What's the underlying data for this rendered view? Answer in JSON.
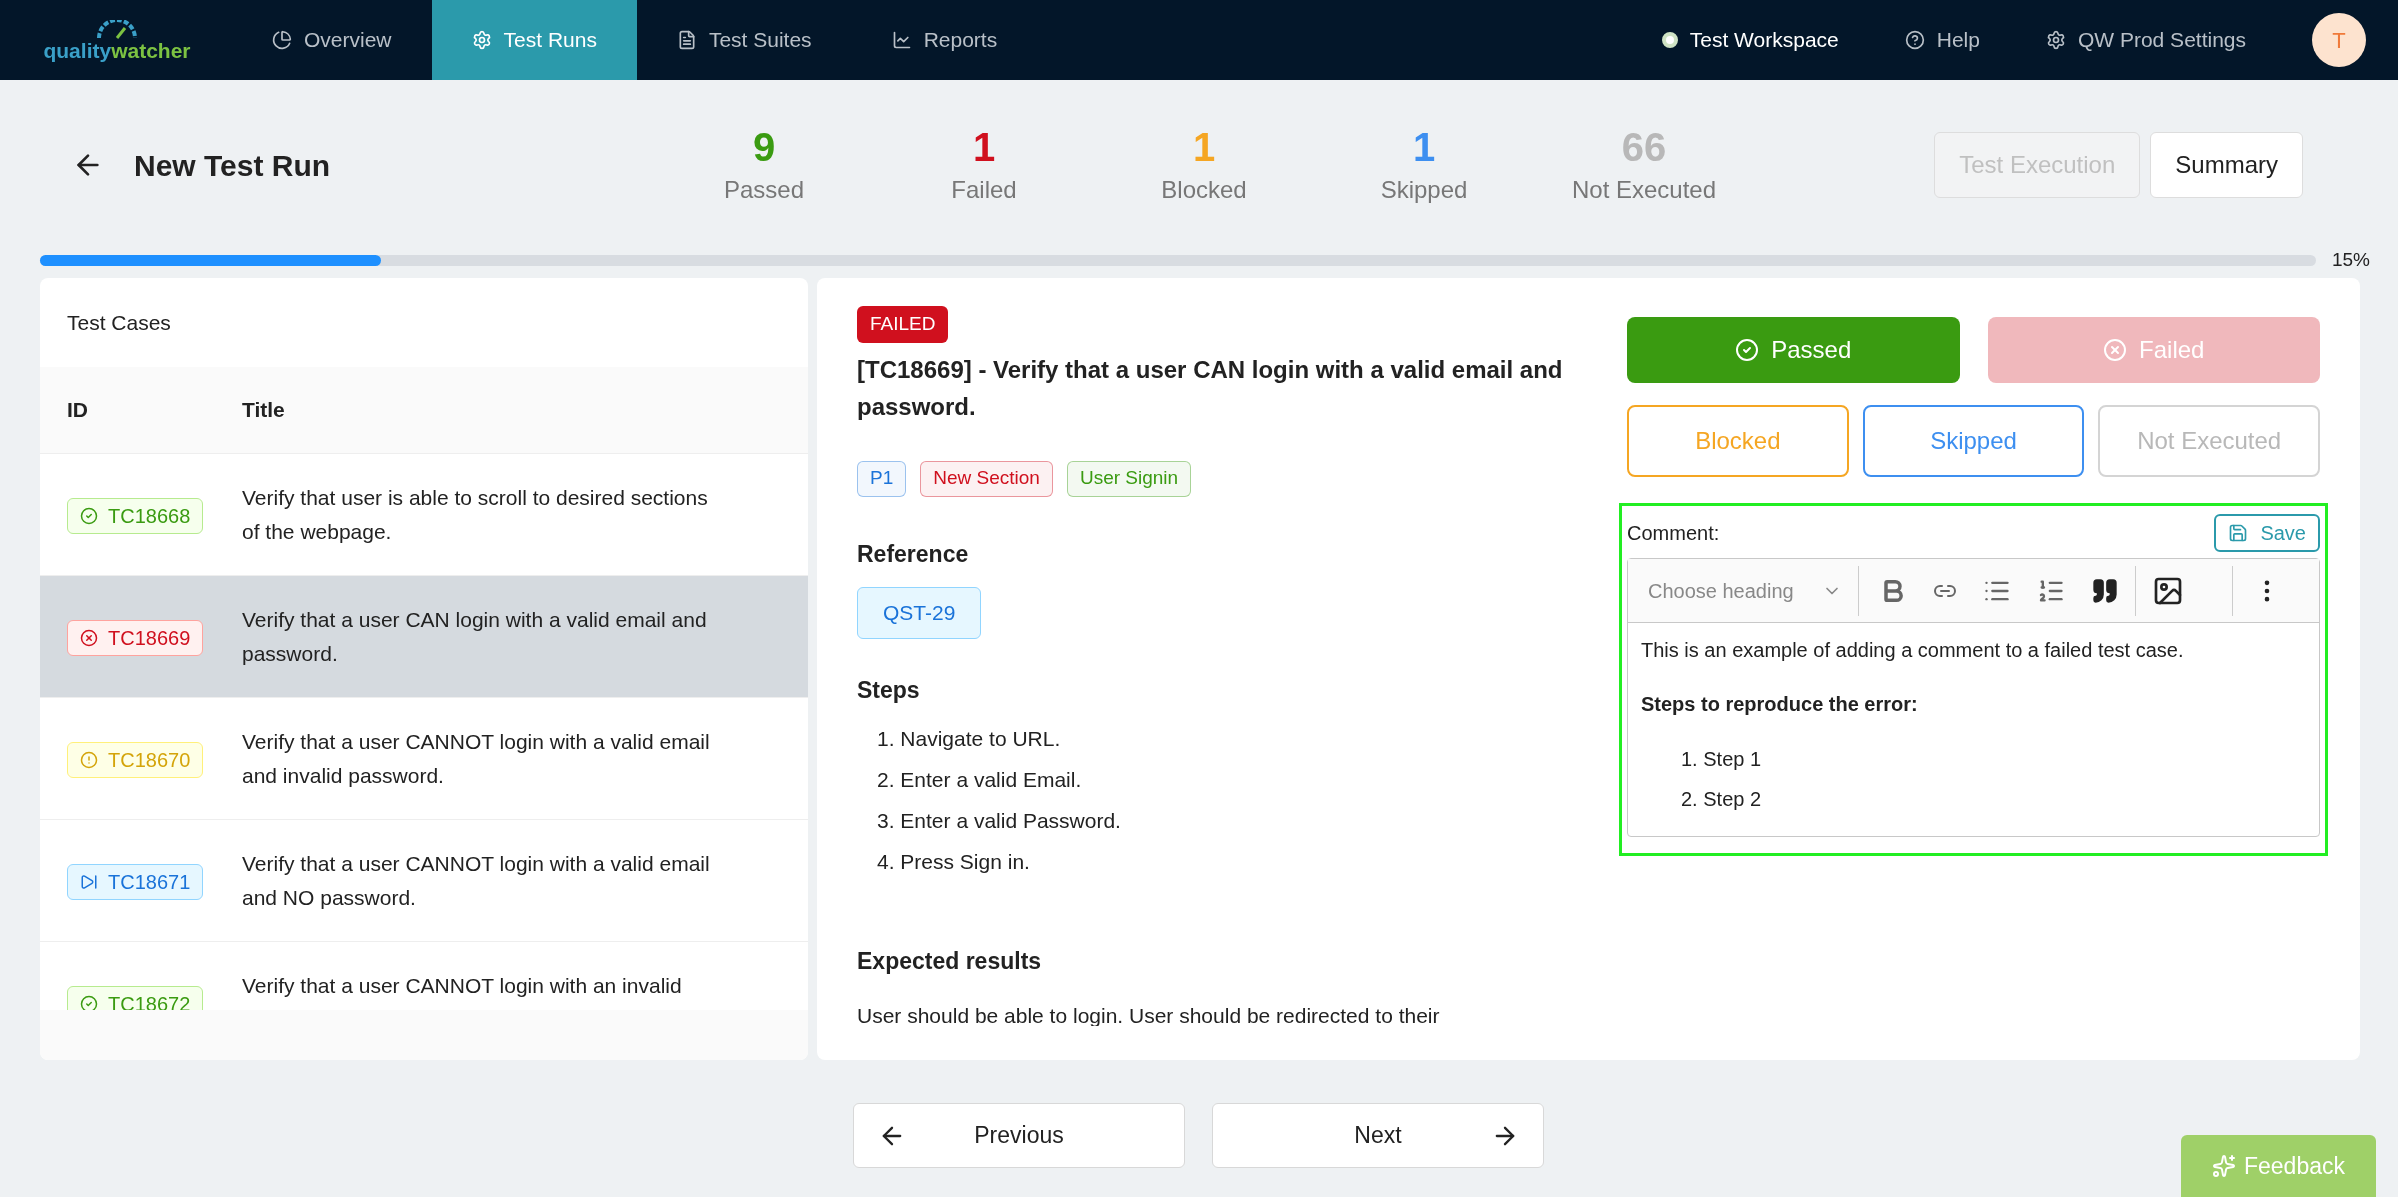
{
  "nav": {
    "logo": [
      "quality",
      "watcher"
    ],
    "items": [
      {
        "label": "Overview",
        "selected": false
      },
      {
        "label": "Test Runs",
        "selected": true
      },
      {
        "label": "Test Suites",
        "selected": false
      },
      {
        "label": "Reports",
        "selected": false
      }
    ],
    "right": [
      "Test Workspace",
      "Help",
      "QW Prod Settings"
    ],
    "avatar": "T"
  },
  "header": {
    "title": "New Test Run",
    "stats": [
      {
        "value": "9",
        "label": "Passed",
        "color": "#3a9b11"
      },
      {
        "value": "1",
        "label": "Failed",
        "color": "#d0101e"
      },
      {
        "value": "1",
        "label": "Blocked",
        "color": "#f5a623"
      },
      {
        "value": "1",
        "label": "Skipped",
        "color": "#3d8ff0"
      },
      {
        "value": "66",
        "label": "Not Executed",
        "color": "#b8b8b8"
      }
    ],
    "buttons": [
      {
        "label": "Test Execution",
        "disabled": true
      },
      {
        "label": "Summary",
        "disabled": false
      }
    ],
    "progress": {
      "level": 0.15,
      "reading": "15%"
    }
  },
  "test_cases": {
    "title": "Test Cases",
    "columns": [
      "ID",
      "Title"
    ],
    "rows": [
      {
        "id": "TC18668",
        "kind": "passed",
        "title": "Verify that user is able to scroll to desired sections of the webpage.",
        "selected": false
      },
      {
        "id": "TC18669",
        "kind": "failed",
        "title": "Verify that a user CAN login with a valid email and password.",
        "selected": true
      },
      {
        "id": "TC18670",
        "kind": "blocked",
        "title": "Verify that a user CANNOT login with a valid email and invalid password.",
        "selected": false
      },
      {
        "id": "TC18671",
        "kind": "skipped",
        "title": "Verify that a user CANNOT login with a valid email and NO password.",
        "selected": false
      },
      {
        "id": "TC18672",
        "kind": "passed",
        "title": "Verify that a user CANNOT login with an invalid",
        "selected": false
      }
    ]
  },
  "detail": {
    "status": "FAILED",
    "title": "[TC18669] - Verify that a user CAN login with a valid email and password.",
    "tags": [
      {
        "text": "P1",
        "color": "#1a73d9"
      },
      {
        "text": "New Section",
        "color": "#d0101e"
      },
      {
        "text": "User Signin",
        "color": "#3a9b11"
      }
    ],
    "reference_heading": "Reference",
    "reference": "QST-29",
    "steps_heading": "Steps",
    "steps": [
      "1. Navigate to URL.",
      "2. Enter a valid Email.",
      "3. Enter a valid Password.",
      "4. Press Sign in."
    ],
    "expected_heading": "Expected results",
    "expected": "User should be able to login. User should be redirected to their"
  },
  "results": [
    {
      "label": "Passed",
      "kind": "passed",
      "selected": false
    },
    {
      "label": "Failed",
      "kind": "failed",
      "selected": true
    },
    {
      "label": "Blocked",
      "kind": "blocked",
      "selected": false
    },
    {
      "label": "Skipped",
      "kind": "skipped",
      "selected": false
    },
    {
      "label": "Not Executed",
      "kind": "not_executed",
      "selected": false
    }
  ],
  "comment": {
    "label": "Comment:",
    "save": "Save",
    "heading_placeholder": "Choose heading",
    "paragraph": "This is an example of adding a comment to a failed test case.",
    "subheading": "Steps to reproduce the error:",
    "list": [
      "1. Step 1",
      "2. Step 2"
    ]
  },
  "footer": {
    "previous": "Previous",
    "next": "Next",
    "feedback": "Feedback"
  }
}
